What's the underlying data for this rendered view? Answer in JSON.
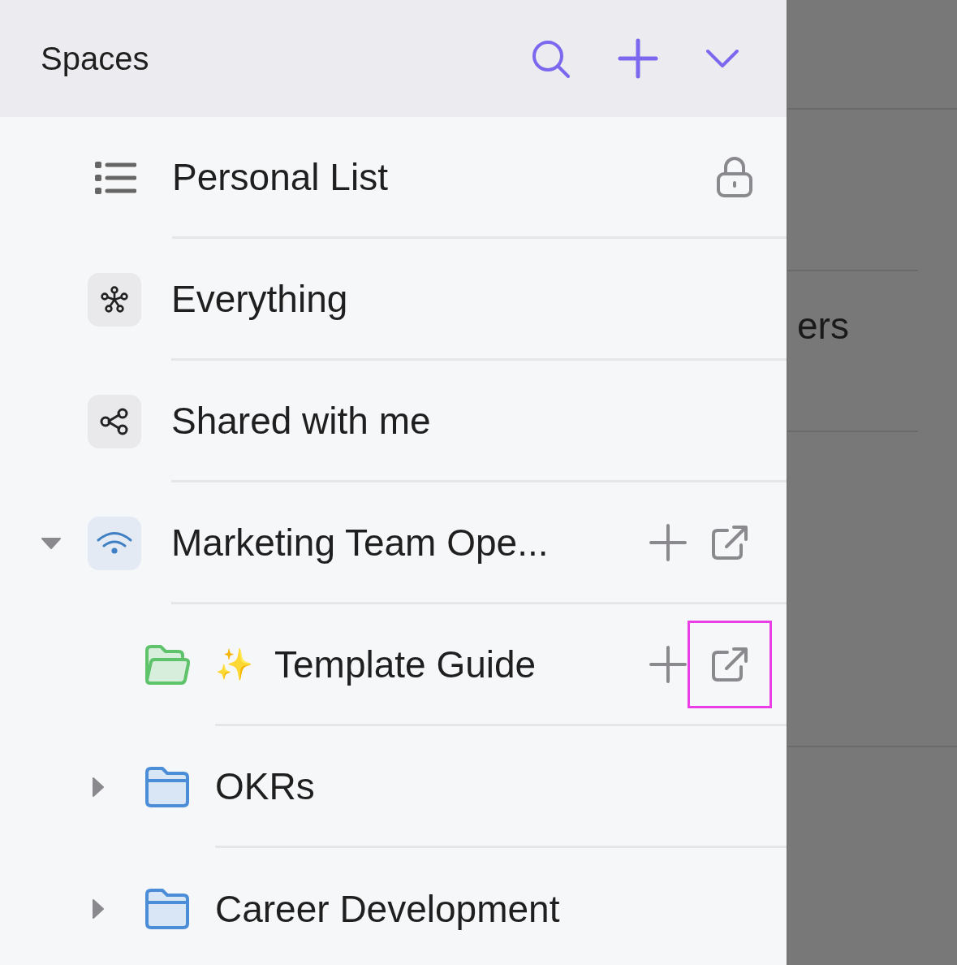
{
  "header": {
    "title": "Spaces"
  },
  "rows": [
    {
      "kind": "list",
      "label": "Personal List",
      "locked": true
    },
    {
      "kind": "everything",
      "label": "Everything"
    },
    {
      "kind": "shared",
      "label": "Shared with me"
    },
    {
      "kind": "space",
      "label": "Marketing Team Ope...",
      "expanded": true,
      "actions": [
        {
          "kind": "add",
          "highlighted": false
        },
        {
          "kind": "open",
          "highlighted": false
        }
      ],
      "children": [
        {
          "kind": "folder-open",
          "emoji": "✨",
          "label": "Template Guide",
          "actions": [
            {
              "kind": "add",
              "highlighted": false
            },
            {
              "kind": "open",
              "highlighted": true
            }
          ]
        },
        {
          "kind": "folder",
          "label": "OKRs",
          "expanded": false
        },
        {
          "kind": "folder",
          "label": "Career Development",
          "expanded": false
        }
      ]
    }
  ],
  "background": {
    "text": "ers"
  }
}
